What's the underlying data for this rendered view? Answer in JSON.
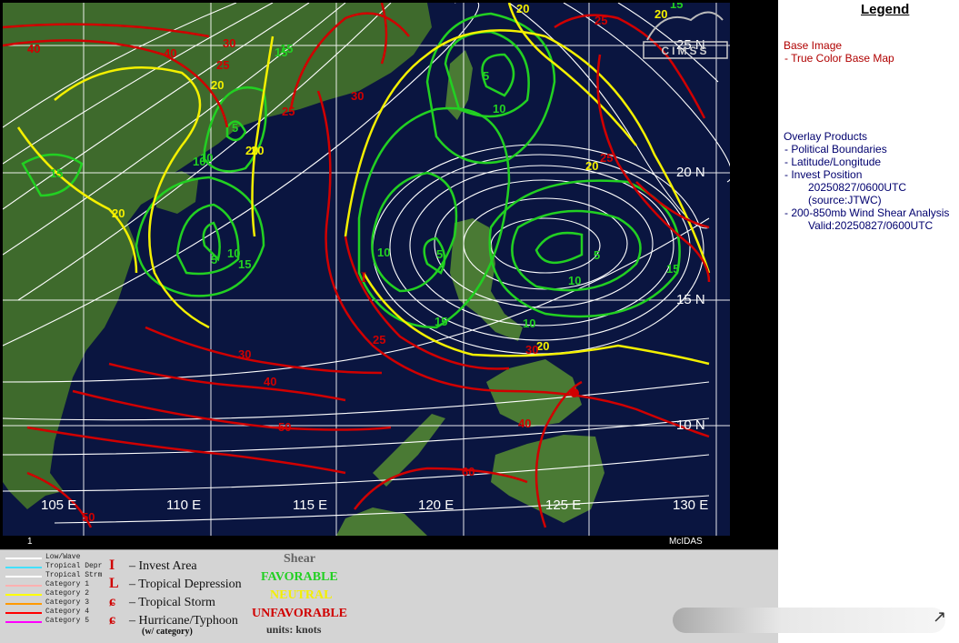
{
  "map": {
    "lon_labels": [
      "105 E",
      "110 E",
      "115 E",
      "120 E",
      "125 E",
      "130 E"
    ],
    "lat_labels": [
      "25 N",
      "20 N",
      "15 N",
      "10 N"
    ],
    "frame_number": "1",
    "credit": "McIDAS",
    "watermark": "CIMSS",
    "invest_marker": "I",
    "colors": {
      "ocean": "#0a1540",
      "land": "#3e6a2c",
      "streamline": "#ffffff",
      "favorable": "#22d022",
      "neutral": "#f4f000",
      "unfavorable": "#d00000"
    },
    "contour_labels": [
      {
        "text": "40",
        "color": "red",
        "pos": "tl"
      },
      {
        "text": "40",
        "color": "red",
        "pos": "tl2"
      },
      {
        "text": "30",
        "color": "red",
        "pos": "t1"
      },
      {
        "text": "25",
        "color": "red",
        "pos": "t2"
      },
      {
        "text": "20",
        "color": "yellow",
        "pos": "t3"
      },
      {
        "text": "15",
        "color": "green",
        "pos": "t4"
      },
      {
        "text": "5",
        "color": "green",
        "pos": "t5"
      },
      {
        "text": "10",
        "color": "green",
        "pos": "t6"
      },
      {
        "text": "20",
        "color": "yellow",
        "pos": "t7"
      },
      {
        "text": "25",
        "color": "red",
        "pos": "t8"
      },
      {
        "text": "30",
        "color": "red",
        "pos": "t9"
      },
      {
        "text": "15",
        "color": "green",
        "pos": "t10"
      },
      {
        "text": "20",
        "color": "yellow",
        "pos": "t11"
      },
      {
        "text": "10",
        "color": "green",
        "pos": "t12"
      },
      {
        "text": "5",
        "color": "green",
        "pos": "t13"
      },
      {
        "text": "10",
        "color": "green",
        "pos": "t14"
      },
      {
        "text": "15",
        "color": "green",
        "pos": "t15"
      },
      {
        "text": "5",
        "color": "green",
        "pos": "t16"
      },
      {
        "text": "10",
        "color": "green",
        "pos": "t17"
      },
      {
        "text": "20",
        "color": "yellow",
        "pos": "t18"
      },
      {
        "text": "25",
        "color": "red",
        "pos": "t19"
      },
      {
        "text": "25",
        "color": "red",
        "pos": "t20"
      },
      {
        "text": "20",
        "color": "yellow",
        "pos": "t21"
      },
      {
        "text": "15",
        "color": "green",
        "pos": "t22"
      },
      {
        "text": "10",
        "color": "green",
        "pos": "t23"
      },
      {
        "text": "5",
        "color": "green",
        "pos": "t24"
      },
      {
        "text": "10",
        "color": "green",
        "pos": "t25"
      },
      {
        "text": "5",
        "color": "green",
        "pos": "t26"
      },
      {
        "text": "10",
        "color": "green",
        "pos": "t27"
      },
      {
        "text": "15",
        "color": "green",
        "pos": "t28"
      },
      {
        "text": "20",
        "color": "yellow",
        "pos": "t29"
      },
      {
        "text": "15",
        "color": "green",
        "pos": "t30"
      },
      {
        "text": "25",
        "color": "red",
        "pos": "t31"
      },
      {
        "text": "30",
        "color": "red",
        "pos": "t32"
      },
      {
        "text": "30",
        "color": "red",
        "pos": "t33"
      },
      {
        "text": "40",
        "color": "red",
        "pos": "t34"
      },
      {
        "text": "50",
        "color": "red",
        "pos": "t35"
      },
      {
        "text": "40",
        "color": "red",
        "pos": "t36"
      },
      {
        "text": "60",
        "color": "red",
        "pos": "t37"
      },
      {
        "text": "50",
        "color": "red",
        "pos": "t38"
      },
      {
        "text": "20",
        "color": "yellow",
        "pos": "t39"
      },
      {
        "text": "15",
        "color": "green",
        "pos": "t40"
      },
      {
        "text": "20",
        "color": "yellow",
        "pos": "t41"
      }
    ]
  },
  "legend": {
    "title": "Legend",
    "base_image_heading": "Base Image",
    "base_image_item": "-  True Color Base Map",
    "overlay_heading": "Overlay Products",
    "overlay_items": [
      "-  Political Boundaries",
      "-  Latitude/Longitude",
      "-  Invest Position"
    ],
    "invest_time": "20250827/0600UTC",
    "invest_source": "(source:JTWC)",
    "shear_item": "-  200-850mb Wind Shear Analysis",
    "shear_valid": "Valid:20250827/0600UTC"
  },
  "key": {
    "track_types": [
      {
        "label": "Low/Wave",
        "color": "#ffffff"
      },
      {
        "label": "Tropical Depr",
        "color": "#44e0ff"
      },
      {
        "label": "Tropical Strm",
        "color": "#ffffff"
      },
      {
        "label": "Category 1",
        "color": "#ffb0b0"
      },
      {
        "label": "Category 2",
        "color": "#ffff00"
      },
      {
        "label": "Category 3",
        "color": "#ff9900"
      },
      {
        "label": "Category 4",
        "color": "#ff0000"
      },
      {
        "label": "Category 5",
        "color": "#ff00ff"
      }
    ],
    "symbols": [
      {
        "sym": "I",
        "label": "– Invest Area"
      },
      {
        "sym": "L",
        "label": "– Tropical Depression"
      },
      {
        "sym": "ɕ",
        "label": "– Tropical Storm"
      },
      {
        "sym": "ɕ",
        "label": "– Hurricane/Typhoon"
      }
    ],
    "category_note": "(w/ category)",
    "shear_heading": "Shear",
    "favorable": "FAVORABLE",
    "neutral": "NEUTRAL",
    "unfavorable": "UNFAVORABLE",
    "units": "units: knots"
  }
}
